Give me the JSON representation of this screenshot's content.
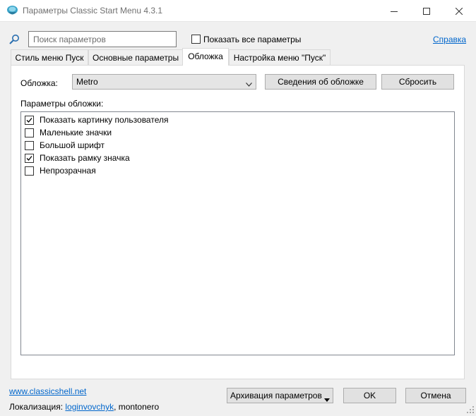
{
  "window": {
    "title": "Параметры Classic Start Menu 4.3.1",
    "icon": "shell-icon",
    "controls": [
      "minimize-icon",
      "maximize-icon",
      "close-icon"
    ]
  },
  "search": {
    "placeholder": "Поиск параметров",
    "value": ""
  },
  "show_all": {
    "label": "Показать все параметры",
    "checked": false
  },
  "help_link": "Справка",
  "tabs": [
    {
      "label": "Стиль меню Пуск",
      "active": false
    },
    {
      "label": "Основные параметры",
      "active": false
    },
    {
      "label": "Обложка",
      "active": true
    },
    {
      "label": "Настройка меню \"Пуск\"",
      "active": false
    }
  ],
  "skin": {
    "label": "Обложка:",
    "selected": "Metro",
    "info_button": "Сведения об обложке",
    "reset_button": "Сбросить",
    "options_label": "Параметры обложки:",
    "options": [
      {
        "label": "Показать картинку пользователя",
        "checked": true
      },
      {
        "label": "Маленькие значки",
        "checked": false
      },
      {
        "label": "Большой шрифт",
        "checked": false
      },
      {
        "label": "Показать рамку значка",
        "checked": true
      },
      {
        "label": "Непрозрачная",
        "checked": false
      }
    ]
  },
  "footer": {
    "website": "www.classicshell.net",
    "localization_label": "Локализация:",
    "localization_author_link": "loginvovchyk",
    "localization_other": ", montonero",
    "backup_button": "Архивация параметров",
    "ok_button": "OK",
    "cancel_button": "Отмена"
  },
  "colors": {
    "link": "#0066cc",
    "window_bg": "#f0f0f0",
    "panel_bg": "#ffffff"
  }
}
